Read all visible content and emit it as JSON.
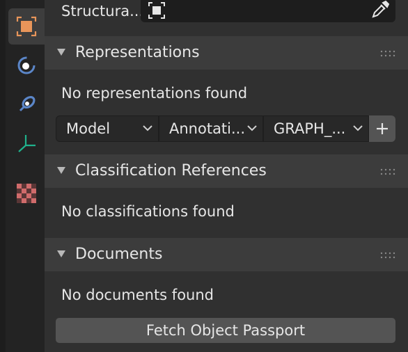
{
  "structural": {
    "label": "Structura..."
  },
  "sections": {
    "representations": {
      "title": "Representations",
      "empty_message": "No representations found",
      "dropdowns": {
        "context": "Model",
        "subcontext": "Annotati...",
        "target_view": "GRAPH_..."
      }
    },
    "classification": {
      "title": "Classification References",
      "empty_message": "No classifications found"
    },
    "documents": {
      "title": "Documents",
      "empty_message": "No documents found",
      "fetch_button": "Fetch Object Passport"
    }
  },
  "tabs": [
    "object-tab",
    "physics-tab",
    "constraints-tab",
    "data-tab",
    "material-tab"
  ],
  "colors": {
    "object_orange": "#e8955a",
    "physics_blue": "#5b86c8",
    "data_green": "#20b28c",
    "material_red": "#d06b6b"
  }
}
